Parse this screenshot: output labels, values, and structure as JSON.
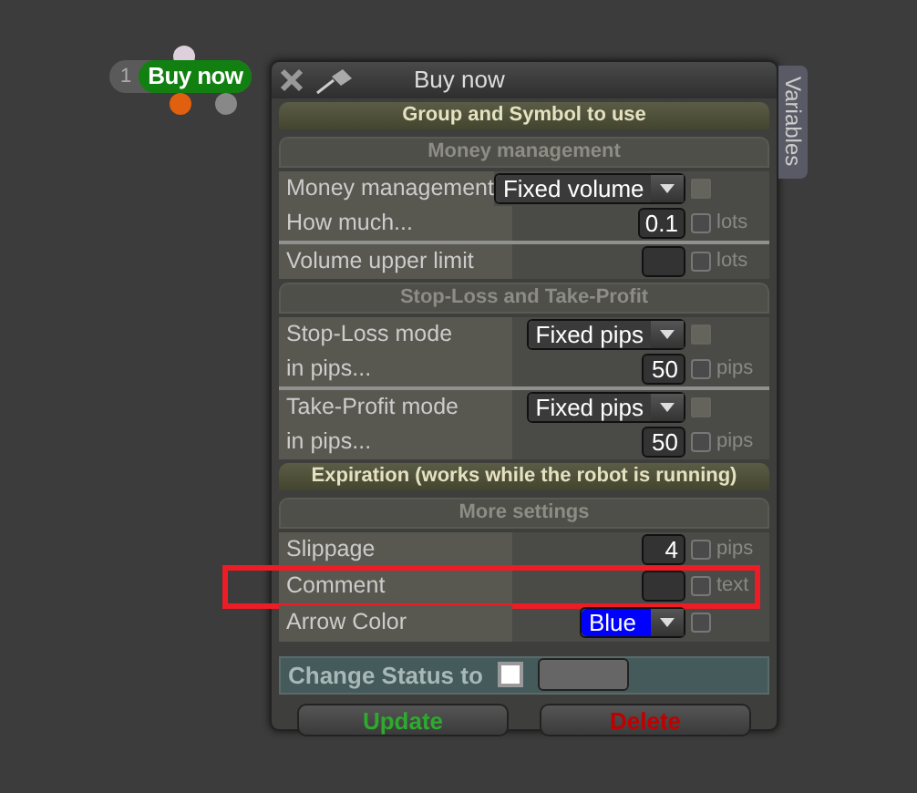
{
  "node": {
    "number": "1",
    "label": "Buy now"
  },
  "window": {
    "title": "Buy now",
    "side_tab": "Variables"
  },
  "sections": [
    {
      "title": "Group and Symbol to use",
      "kind": "primary"
    },
    {
      "title": "Money management",
      "kind": "secondary",
      "groups": [
        [
          {
            "label": "Money management",
            "kind": "select",
            "value": "Fixed volume",
            "checked": false,
            "disabled": true
          },
          {
            "label": "How much...",
            "kind": "number",
            "value": "0.1",
            "unit": "lots",
            "checked": false,
            "disabled": false
          }
        ],
        [
          {
            "label": "Volume upper limit",
            "kind": "number",
            "unit": "lots",
            "checked": false,
            "disabled": false
          }
        ]
      ]
    },
    {
      "title": "Stop-Loss and Take-Profit",
      "kind": "secondary",
      "groups": [
        [
          {
            "label": "Stop-Loss mode",
            "kind": "select",
            "value": "Fixed pips",
            "checked": false,
            "disabled": true
          },
          {
            "label": "in pips...",
            "kind": "number",
            "value": "50",
            "unit": "pips",
            "checked": false,
            "disabled": false
          }
        ],
        [
          {
            "label": "Take-Profit mode",
            "kind": "select",
            "value": "Fixed pips",
            "checked": false,
            "disabled": true
          },
          {
            "label": "in pips...",
            "kind": "number",
            "value": "50",
            "unit": "pips",
            "checked": false,
            "disabled": false
          }
        ]
      ]
    },
    {
      "title": "Expiration (works while the robot is running)",
      "kind": "primary"
    },
    {
      "title": "More settings",
      "kind": "secondary",
      "groups": [
        [
          {
            "label": "Slippage",
            "kind": "number",
            "value": "4",
            "unit": "pips",
            "checked": false,
            "disabled": false
          },
          {
            "label": "Comment",
            "kind": "number",
            "unit": "text",
            "checked": false,
            "disabled": false,
            "highlighted": true
          },
          {
            "label": "Arrow Color",
            "kind": "color",
            "value": "Blue",
            "color": "#0000ff",
            "checked": false,
            "disabled": false
          }
        ]
      ]
    }
  ],
  "status": {
    "label": "Change Status to",
    "checked": false
  },
  "buttons": [
    {
      "label": "Update",
      "kind": "ok"
    },
    {
      "label": "Delete",
      "kind": "danger"
    }
  ]
}
